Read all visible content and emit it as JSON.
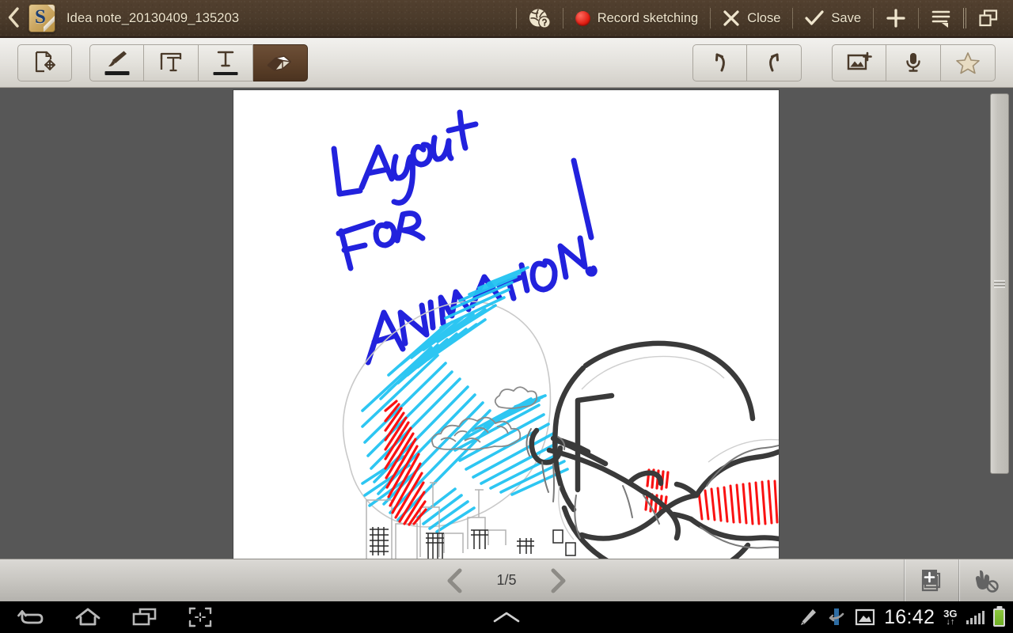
{
  "titlebar": {
    "back_icon": "chevron-left-icon",
    "app_icon": "s-note-app-icon",
    "app_icon_letter": "S",
    "note_title": "Idea note_20130409_135203",
    "help_icon": "globe-help-icon",
    "record_label": "Record sketching",
    "record_icon": "record-dot-icon",
    "close_label": "Close",
    "close_icon": "close-x-icon",
    "save_label": "Save",
    "save_icon": "check-icon",
    "add_icon": "plus-icon",
    "menu_icon": "list-menu-icon",
    "multiwindow_icon": "multi-window-icon",
    "bg_color": "#4a3a2a",
    "text_color": "#efe5cd"
  },
  "toolbar": {
    "select_move": {
      "name": "select-move-tool",
      "icon": "shape-move-icon"
    },
    "pen": {
      "name": "pen-tool",
      "icon": "brush-icon"
    },
    "textbox": {
      "name": "text-box-tool",
      "icon": "text-box-icon"
    },
    "text": {
      "name": "text-tool",
      "icon": "text-format-icon"
    },
    "eraser": {
      "name": "eraser-tool",
      "icon": "eraser-icon",
      "active": true
    },
    "undo": {
      "name": "undo-button",
      "icon": "undo-arrow-icon"
    },
    "redo": {
      "name": "redo-button",
      "icon": "redo-arrow-icon"
    },
    "insert_image": {
      "name": "insert-image-button",
      "icon": "image-plus-icon"
    },
    "voice": {
      "name": "voice-record-button",
      "icon": "microphone-icon"
    },
    "favorite": {
      "name": "favorite-button",
      "icon": "star-icon"
    },
    "active_tool": "eraser",
    "accent_color": "#5c4029"
  },
  "canvas": {
    "background_color": "#575757",
    "page_color": "#ffffff",
    "sketch": {
      "handwritten_text_line1": "LAyout",
      "handwritten_text_line2": "FoR",
      "handwritten_text_line3": "ANIMATION !",
      "ink_color": "#2222dd",
      "sky_color": "#22c3f2",
      "cape_color": "#fa1212",
      "outline_color": "#3a3a3a",
      "description": "flying superhero figure with red cape over blue sky and city skyline"
    },
    "scrollbar": {
      "name": "vertical-scrollbar",
      "grip": "scroll-grip"
    }
  },
  "pagebar": {
    "prev_icon": "chevron-left-icon",
    "next_icon": "chevron-right-icon",
    "page_indicator": "1/5",
    "add_page_icon": "add-page-icon",
    "palm_reject_icon": "palm-rejection-icon"
  },
  "systembar": {
    "back_icon": "android-back-icon",
    "home_icon": "android-home-icon",
    "recents_icon": "android-recents-icon",
    "screenshot_icon": "screen-capture-icon",
    "expand_icon": "chevron-up-icon",
    "spen_icon": "s-pen-icon",
    "sync_icon": "sync-icon",
    "screenshot_saved_icon": "image-icon",
    "clock": "16:42",
    "network_type": "3G",
    "network_arrows": "↓↑",
    "signal_icon": "signal-bars-icon",
    "battery_icon": "battery-full-icon",
    "battery_color": "#7db52c"
  }
}
